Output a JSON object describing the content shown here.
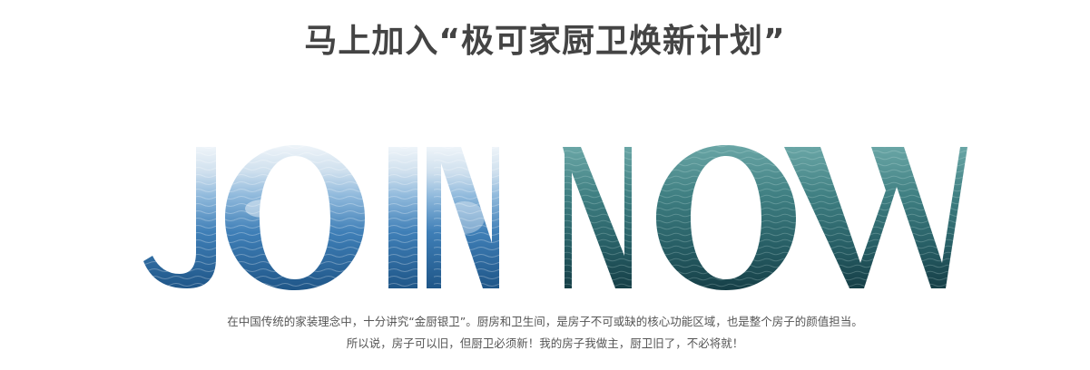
{
  "headline": "马上加入“极可家厨卫焕新计划”",
  "hero": {
    "word_1": "JOIN",
    "word_2": "NOW",
    "colors": {
      "sky": "#e9f1f7",
      "wave_light": "#9cc4e2",
      "sea_blue": "#2f6fa8",
      "sea_deep": "#1d4f7c",
      "teal_light": "#5c9e9a",
      "teal": "#2e6b6e",
      "teal_deep": "#153f46"
    }
  },
  "tagline": {
    "line_1": "在中国传统的家装理念中，十分讲究“金厨银卫”。厨房和卫生间，是房子不可或缺的核心功能区域，也是整个房子的颜值担当。",
    "line_2": "所以说，房子可以旧，但厨卫必须新！我的房子我做主，厨卫旧了，不必将就！"
  }
}
